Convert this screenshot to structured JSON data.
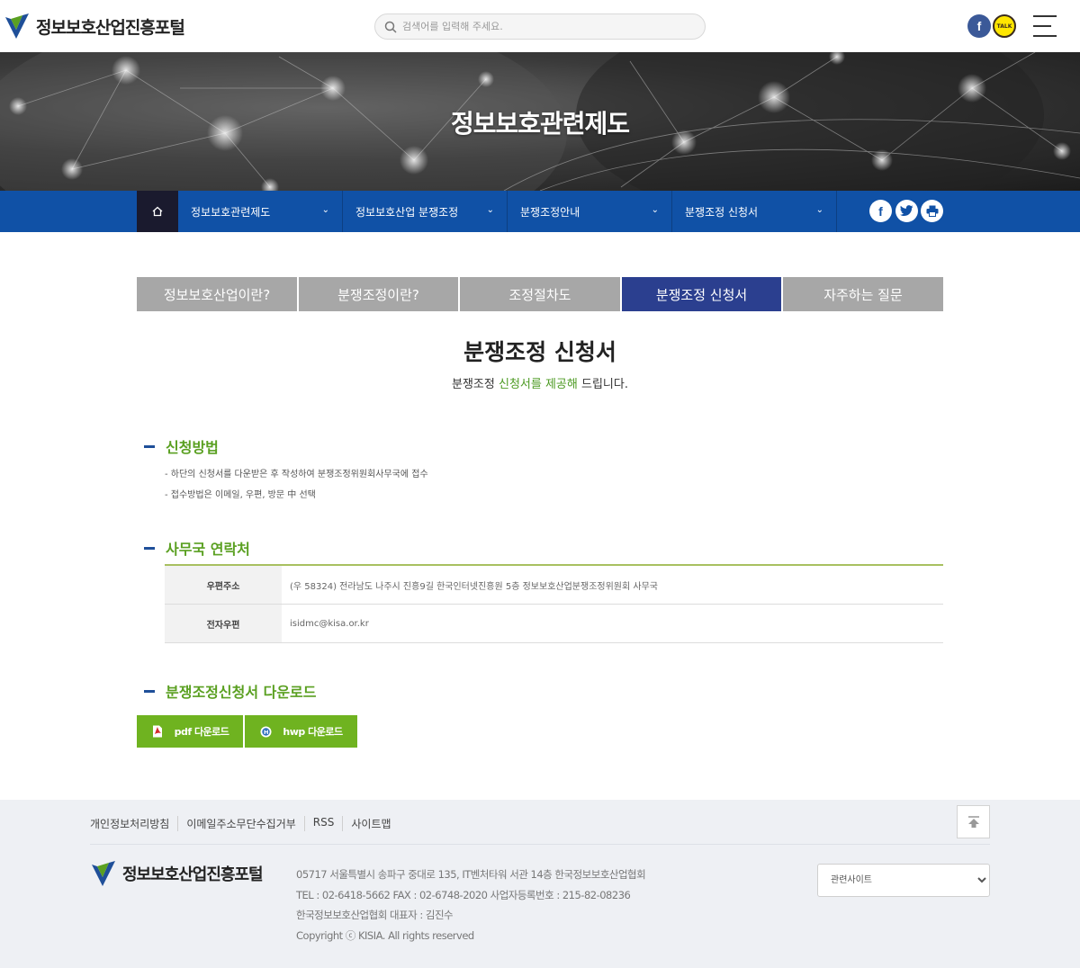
{
  "header": {
    "logo_text": "정보보호산업진흥포털",
    "search_placeholder": "검색어를 입력해 주세요.",
    "facebook_glyph": "f",
    "kakao_text": "TALK"
  },
  "banner": {
    "title": "정보보호관련제도"
  },
  "subnav": {
    "items": [
      {
        "label": "정보보호관련제도"
      },
      {
        "label": "정보보호산업 분쟁조정"
      },
      {
        "label": "분쟁조정안내"
      },
      {
        "label": "분쟁조정 신청서"
      }
    ],
    "share_facebook": "f",
    "icons": [
      "home-icon",
      "chevron-down-icon",
      "facebook-icon",
      "twitter-icon",
      "print-icon"
    ]
  },
  "tabs": [
    {
      "label": "정보보호산업이란?",
      "active": false
    },
    {
      "label": "분쟁조정이란?",
      "active": false
    },
    {
      "label": "조정절차도",
      "active": false
    },
    {
      "label": "분쟁조정 신청서",
      "active": true
    },
    {
      "label": "자주하는 질문",
      "active": false
    }
  ],
  "page": {
    "title": "분쟁조정 신청서",
    "desc_prefix": "분쟁조정 ",
    "desc_highlight": "신청서를 제공해",
    "desc_suffix": " 드립니다."
  },
  "method": {
    "title": "신청방법",
    "items": [
      "- 하단의 신청서를 다운받은 후 작성하여 분쟁조정위원회사무국에 접수",
      "- 접수방법은 이메일, 우편, 방문 中 선택"
    ]
  },
  "contact": {
    "title": "사무국 연락처",
    "rows": [
      {
        "label": "우편주소",
        "value": "(우 58324) 전라남도 나주시 진흥9길 한국인터넷진흥원 5층 정보보호산업분쟁조정위원회 사무국"
      },
      {
        "label": "전자우편",
        "value": "isidmc@kisa.or.kr"
      }
    ]
  },
  "download": {
    "title": "분쟁조정신청서 다운로드",
    "pdf_label": "pdf 다운로드",
    "hwp_label": "hwp 다운로드"
  },
  "footer": {
    "links": [
      "개인정보처리방침",
      "이메일주소무단수집거부",
      "RSS",
      "사이트맵"
    ],
    "logo_text": "정보보호산업진흥포털",
    "info": [
      "05717 서울특별시 송파구 중대로 135, IT벤처타워 서관 14층 한국정보보호산업협회",
      "TEL : 02-6418-5662   FAX : 02-6748-2020   사업자등록번호 : 215-82-08236",
      "한국정보보호산업협회 대표자 : 김진수",
      "Copyright ⓒ KISIA. All rights reserved"
    ],
    "site_select": "관련사이트"
  },
  "colors": {
    "nav_blue": "#1051a6",
    "tab_active": "#2b3f8f",
    "tab_inactive": "#a7a7a7",
    "accent_green": "#5aa021",
    "button_green": "#6fb320"
  }
}
